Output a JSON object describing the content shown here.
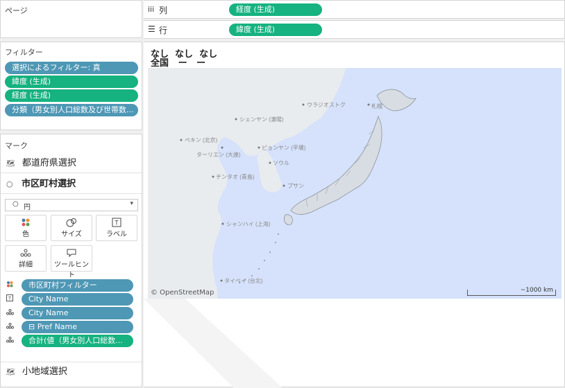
{
  "pages": {
    "title": "ページ"
  },
  "columns_shelf": {
    "icon": "columns-icon",
    "label": "列",
    "pill": "経度 (生成)"
  },
  "rows_shelf": {
    "icon": "rows-icon",
    "label": "行",
    "pill": "緯度 (生成)"
  },
  "filters": {
    "title": "フィルター",
    "items": [
      "選択によるフィルター: 真",
      "緯度 (生成)",
      "経度 (生成)",
      "分類（男女別人口総数及び世帯数..."
    ]
  },
  "marks": {
    "title": "マーク",
    "layers": [
      {
        "icon": "map-layer-icon",
        "label": "都道府県選択"
      },
      {
        "icon": "circle-icon",
        "label": "市区町村選択"
      }
    ],
    "mark_type": "円",
    "mark_type_icon": "circle-icon",
    "cards": [
      {
        "icon": "color-icon",
        "label": "色"
      },
      {
        "icon": "size-icon",
        "label": "サイズ"
      },
      {
        "icon": "label-icon",
        "label": "ラベル"
      },
      {
        "icon": "detail-icon",
        "label": "詳細"
      },
      {
        "icon": "tooltip-icon",
        "label": "ツールヒント"
      }
    ],
    "fields": [
      {
        "icon": "color-icon",
        "label": "市区町村フィルター",
        "color": "blue"
      },
      {
        "icon": "label-icon",
        "label": "City Name",
        "color": "blue"
      },
      {
        "icon": "detail-icon",
        "label": "City Name",
        "color": "blue"
      },
      {
        "icon": "detail-icon",
        "label": "⊟ Pref Name",
        "color": "blue"
      },
      {
        "icon": "detail-icon",
        "label": "合計(値（男女別人口総数...",
        "color": "green"
      }
    ],
    "bottom_layer": {
      "icon": "map-layer-icon",
      "label": "小地域選択"
    }
  },
  "view": {
    "header_line1": "なし  なし  なし",
    "header_line2": "全国   ー   ー",
    "map": {
      "attribution": "© OpenStreetMap",
      "scale_label": "~1000 km",
      "places": [
        "ウラジオストク",
        "札幌",
        "シェンヤン (瀋陽)",
        "ペキン (北京)",
        "ピョンヤン (平壌)",
        "ターリエン (大連)",
        "ソウル",
        "チンタオ (青島)",
        "プサン",
        "シャンハイ (上海)",
        "タイペイ (台北)"
      ]
    }
  },
  "colors": {
    "pill_blue": "#4e97b5",
    "pill_green": "#16b27f",
    "land": "#e9ecef",
    "sea": "#d6e2fb",
    "japan": "#d8dde3"
  }
}
